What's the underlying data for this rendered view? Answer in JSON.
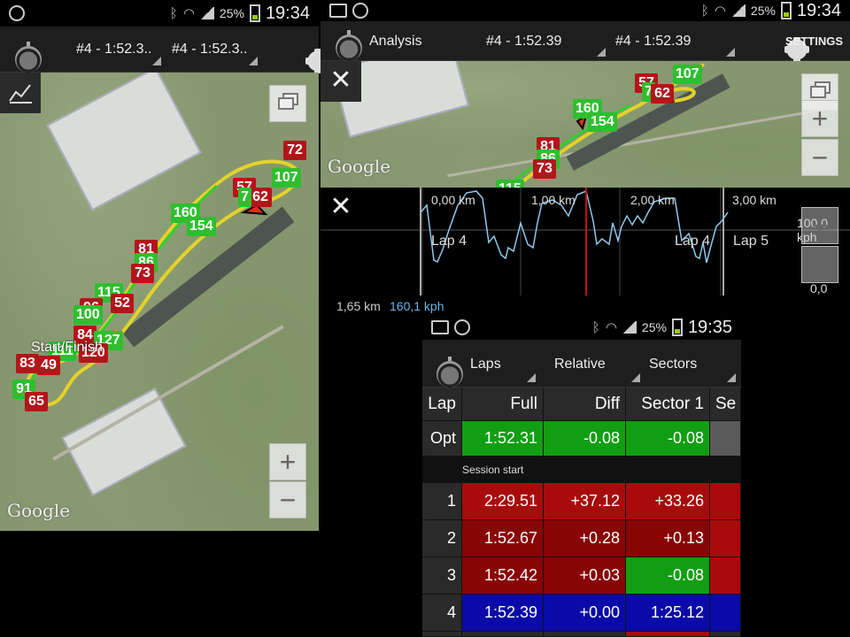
{
  "left_screen": {
    "status": {
      "battery": "25%",
      "time": "19:34"
    },
    "actionbar": {
      "spinner1": "#4 - 1:52.3..",
      "spinner2": "#4 - 1:52.3.."
    },
    "map": {
      "markers": [
        {
          "label": "72",
          "color": "r"
        },
        {
          "label": "107",
          "color": "g"
        },
        {
          "label": "57",
          "color": "r"
        },
        {
          "label": "62",
          "color": "r"
        },
        {
          "label": "7",
          "color": "g"
        },
        {
          "label": "160",
          "color": "g"
        },
        {
          "label": "154",
          "color": "g"
        },
        {
          "label": "81",
          "color": "r"
        },
        {
          "label": "86",
          "color": "g"
        },
        {
          "label": "73",
          "color": "r"
        },
        {
          "label": "115",
          "color": "g"
        },
        {
          "label": "52",
          "color": "r"
        },
        {
          "label": "96",
          "color": "r"
        },
        {
          "label": "100",
          "color": "g"
        },
        {
          "label": "84",
          "color": "r"
        },
        {
          "label": "127",
          "color": "g"
        },
        {
          "label": "111",
          "color": "g"
        },
        {
          "label": "120",
          "color": "r"
        },
        {
          "label": "83",
          "color": "r"
        },
        {
          "label": "49",
          "color": "r"
        },
        {
          "label": "91",
          "color": "g"
        },
        {
          "label": "65",
          "color": "r"
        }
      ],
      "start_finish": "Start/Finish",
      "attribution": "Google",
      "zoom_in": "+",
      "zoom_out": "−"
    }
  },
  "right_screen": {
    "status": {
      "battery": "25%",
      "time": "19:34"
    },
    "actionbar": {
      "title": "Analysis",
      "spinner1": "#4 - 1:52.39",
      "spinner2": "#4 - 1:52.39",
      "settings": "SETTINGS"
    },
    "map": {
      "markers": [
        {
          "label": "107",
          "color": "g"
        },
        {
          "label": "57",
          "color": "r"
        },
        {
          "label": "7",
          "color": "g"
        },
        {
          "label": "62",
          "color": "r"
        },
        {
          "label": "160",
          "color": "g"
        },
        {
          "label": "154",
          "color": "g"
        },
        {
          "label": "81",
          "color": "r"
        },
        {
          "label": "86",
          "color": "g"
        },
        {
          "label": "73",
          "color": "r"
        },
        {
          "label": "115",
          "color": "g"
        }
      ],
      "attribution": "Google",
      "zoom_in": "+",
      "zoom_out": "−"
    },
    "chart": {
      "x_ticks": [
        "0,00 km",
        "1,00 km",
        "2,00 km",
        "3,00 km"
      ],
      "y_labels": [
        "100,0 kph",
        "0,0 kph"
      ],
      "laps": [
        "Lap 4",
        "Lap 4",
        "Lap 5"
      ],
      "zoom_in": "+",
      "zoom_out": "−"
    },
    "footer": {
      "distance": "1,65 km",
      "speed": "160,1 kph"
    }
  },
  "bottom_screen": {
    "status": {
      "battery": "25%",
      "time": "19:35"
    },
    "actionbar": {
      "spinner1": "Laps",
      "spinner2": "Relative",
      "spinner3": "Sectors"
    },
    "table": {
      "headers": [
        "Lap",
        "Full",
        "Diff",
        "Sector 1",
        "Se"
      ],
      "opt_row": {
        "lap": "Opt",
        "full": "1:52.31",
        "diff": "-0.08",
        "s1": "-0.08"
      },
      "session_label": "Session start",
      "rows": [
        {
          "lap": "1",
          "full": "2:29.51",
          "diff": "+37.12",
          "s1": "+33.26"
        },
        {
          "lap": "2",
          "full": "1:52.67",
          "diff": "+0.28",
          "s1": "+0.13"
        },
        {
          "lap": "3",
          "full": "1:52.42",
          "diff": "+0.03",
          "s1": "-0.08"
        },
        {
          "lap": "4",
          "full": "1:52.39",
          "diff": "+0.00",
          "s1": "1:25.12"
        }
      ]
    }
  },
  "colors": {
    "green": "#129e12",
    "red": "#a80b0b",
    "blue": "#0a0aa8",
    "chart_line": "#8ec8ec",
    "cursor": "#c01010",
    "speed_text": "#6cb4e8"
  }
}
